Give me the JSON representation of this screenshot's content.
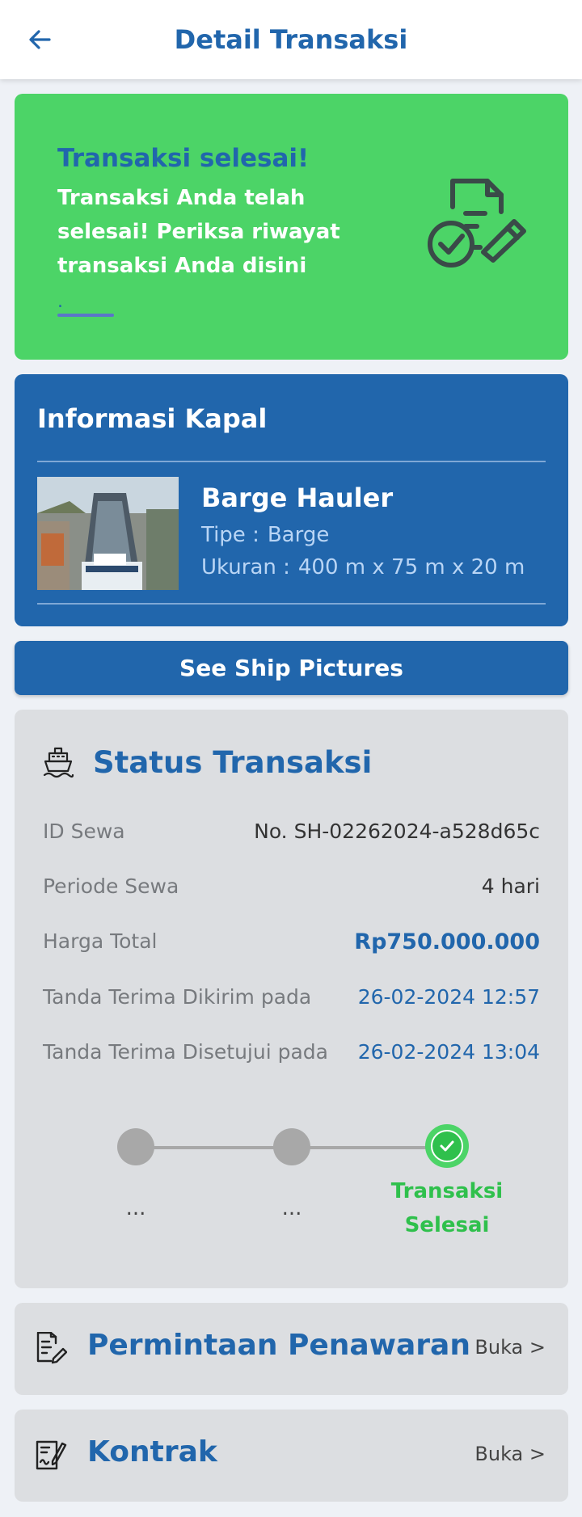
{
  "header": {
    "title": "Detail Transaksi"
  },
  "success_card": {
    "title": "Transaksi selesai!",
    "desc": "Transaksi Anda telah selesai! Periksa riwayat transaksi Anda disini",
    "link_text": "."
  },
  "kapal": {
    "section_title": "Informasi Kapal",
    "name": "Barge Hauler",
    "type_label": "Tipe :",
    "type_value": "Barge",
    "size_label": "Ukuran :",
    "size_value": "400 m x 75 m x 20 m"
  },
  "see_pictures_button": "See Ship Pictures",
  "status": {
    "title": "Status Transaksi",
    "rows": [
      {
        "label": "ID Sewa",
        "value": "No. SH-02262024-a528d65c"
      },
      {
        "label": "Periode Sewa",
        "value": "4 hari"
      },
      {
        "label": "Harga Total",
        "value": "Rp750.000.000"
      },
      {
        "label": "Tanda Terima Dikirim pada",
        "value": "26-02-2024 12:57"
      },
      {
        "label": "Tanda Terima Disetujui pada",
        "value": "26-02-2024 13:04"
      }
    ],
    "steps": [
      {
        "label": "...",
        "done": false
      },
      {
        "label": "...",
        "done": false
      },
      {
        "label_line1": "Transaksi",
        "label_line2": "Selesai",
        "done": true
      }
    ]
  },
  "links": [
    {
      "title": "Permintaan Penawaran",
      "action": "Buka >"
    },
    {
      "title": "Kontrak",
      "action": "Buka >"
    }
  ],
  "colors": {
    "primary": "#2166ac",
    "success": "#4cd467",
    "card_gray": "#dcdee1"
  }
}
